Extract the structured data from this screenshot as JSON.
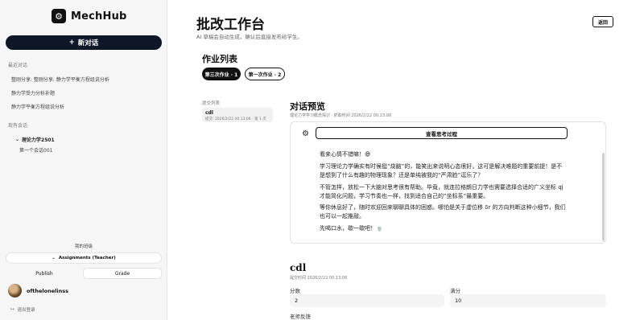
{
  "sidebar": {
    "brand": "MechHub",
    "new_chat": "新对话",
    "recent_label": "最近对话",
    "recent": [
      "整刚分享: 整刚分享: 静力学平衡方程组说分析",
      "静力学受力分析补题",
      "静力学平衡方程组说分析"
    ],
    "existing_label": "现有会话",
    "folder": "理论力学2501",
    "folder_child": "第一个会话001",
    "mine_label": "我的班级",
    "assignments": "Assignments (Teacher)",
    "publish": "Publish",
    "grade": "Grade",
    "user": "ofthelonelinss",
    "logout": "退出登录"
  },
  "header": {
    "title": "批改工作台",
    "subtitle": "AI 草稿会自动生成，确认后直接发布给学生。",
    "back": "返回"
  },
  "list": {
    "title": "作业列表",
    "tabs": [
      {
        "label": "第三次作业 · 1"
      },
      {
        "label": "第一次作业 · 2"
      }
    ]
  },
  "submissions": {
    "label": "提交列表",
    "items": [
      {
        "name": "cdl",
        "meta": "提交: 2026/2/22 00:13:06 · 第 1 次"
      }
    ]
  },
  "preview": {
    "title": "对话预览",
    "meta": "理论力学学习概念探讨 · 抓取时间 2026/2/22 00:13:08",
    "think_button": "查看思考过程",
    "messages": [
      "看来心情不错嘛！😄",
      "学习理论力学确实有时候挺“烧脑”的，能笑出来说明心态很好，这可是解决难题的重要前提！是不是想到了什么有趣的物理现象？还是单纯被我的“严肃脸”逗乐了？",
      "不管怎样，放松一下大脑对思考很有帮助。毕竟，就连拉格朗日力学也需要选择合适的广义坐标 qj 才能简化问题，学习节奏也一样，找到适合自己的“坐标系”最重要。",
      "等你休息好了，随时欢迎回来聊聊具体的困惑。哪怕是关于虚位移 δr 的方向判断这种小细节，我们也可以一起推敲。",
      "先喝口水，歇一歇吧！🍵"
    ]
  },
  "grading": {
    "student": "cdl",
    "time": "提交时间 2026/2/22 00:13:06",
    "score_label": "分数",
    "score": "2",
    "full_label": "满分",
    "full": "10",
    "feedback_label": "老师反馈"
  }
}
